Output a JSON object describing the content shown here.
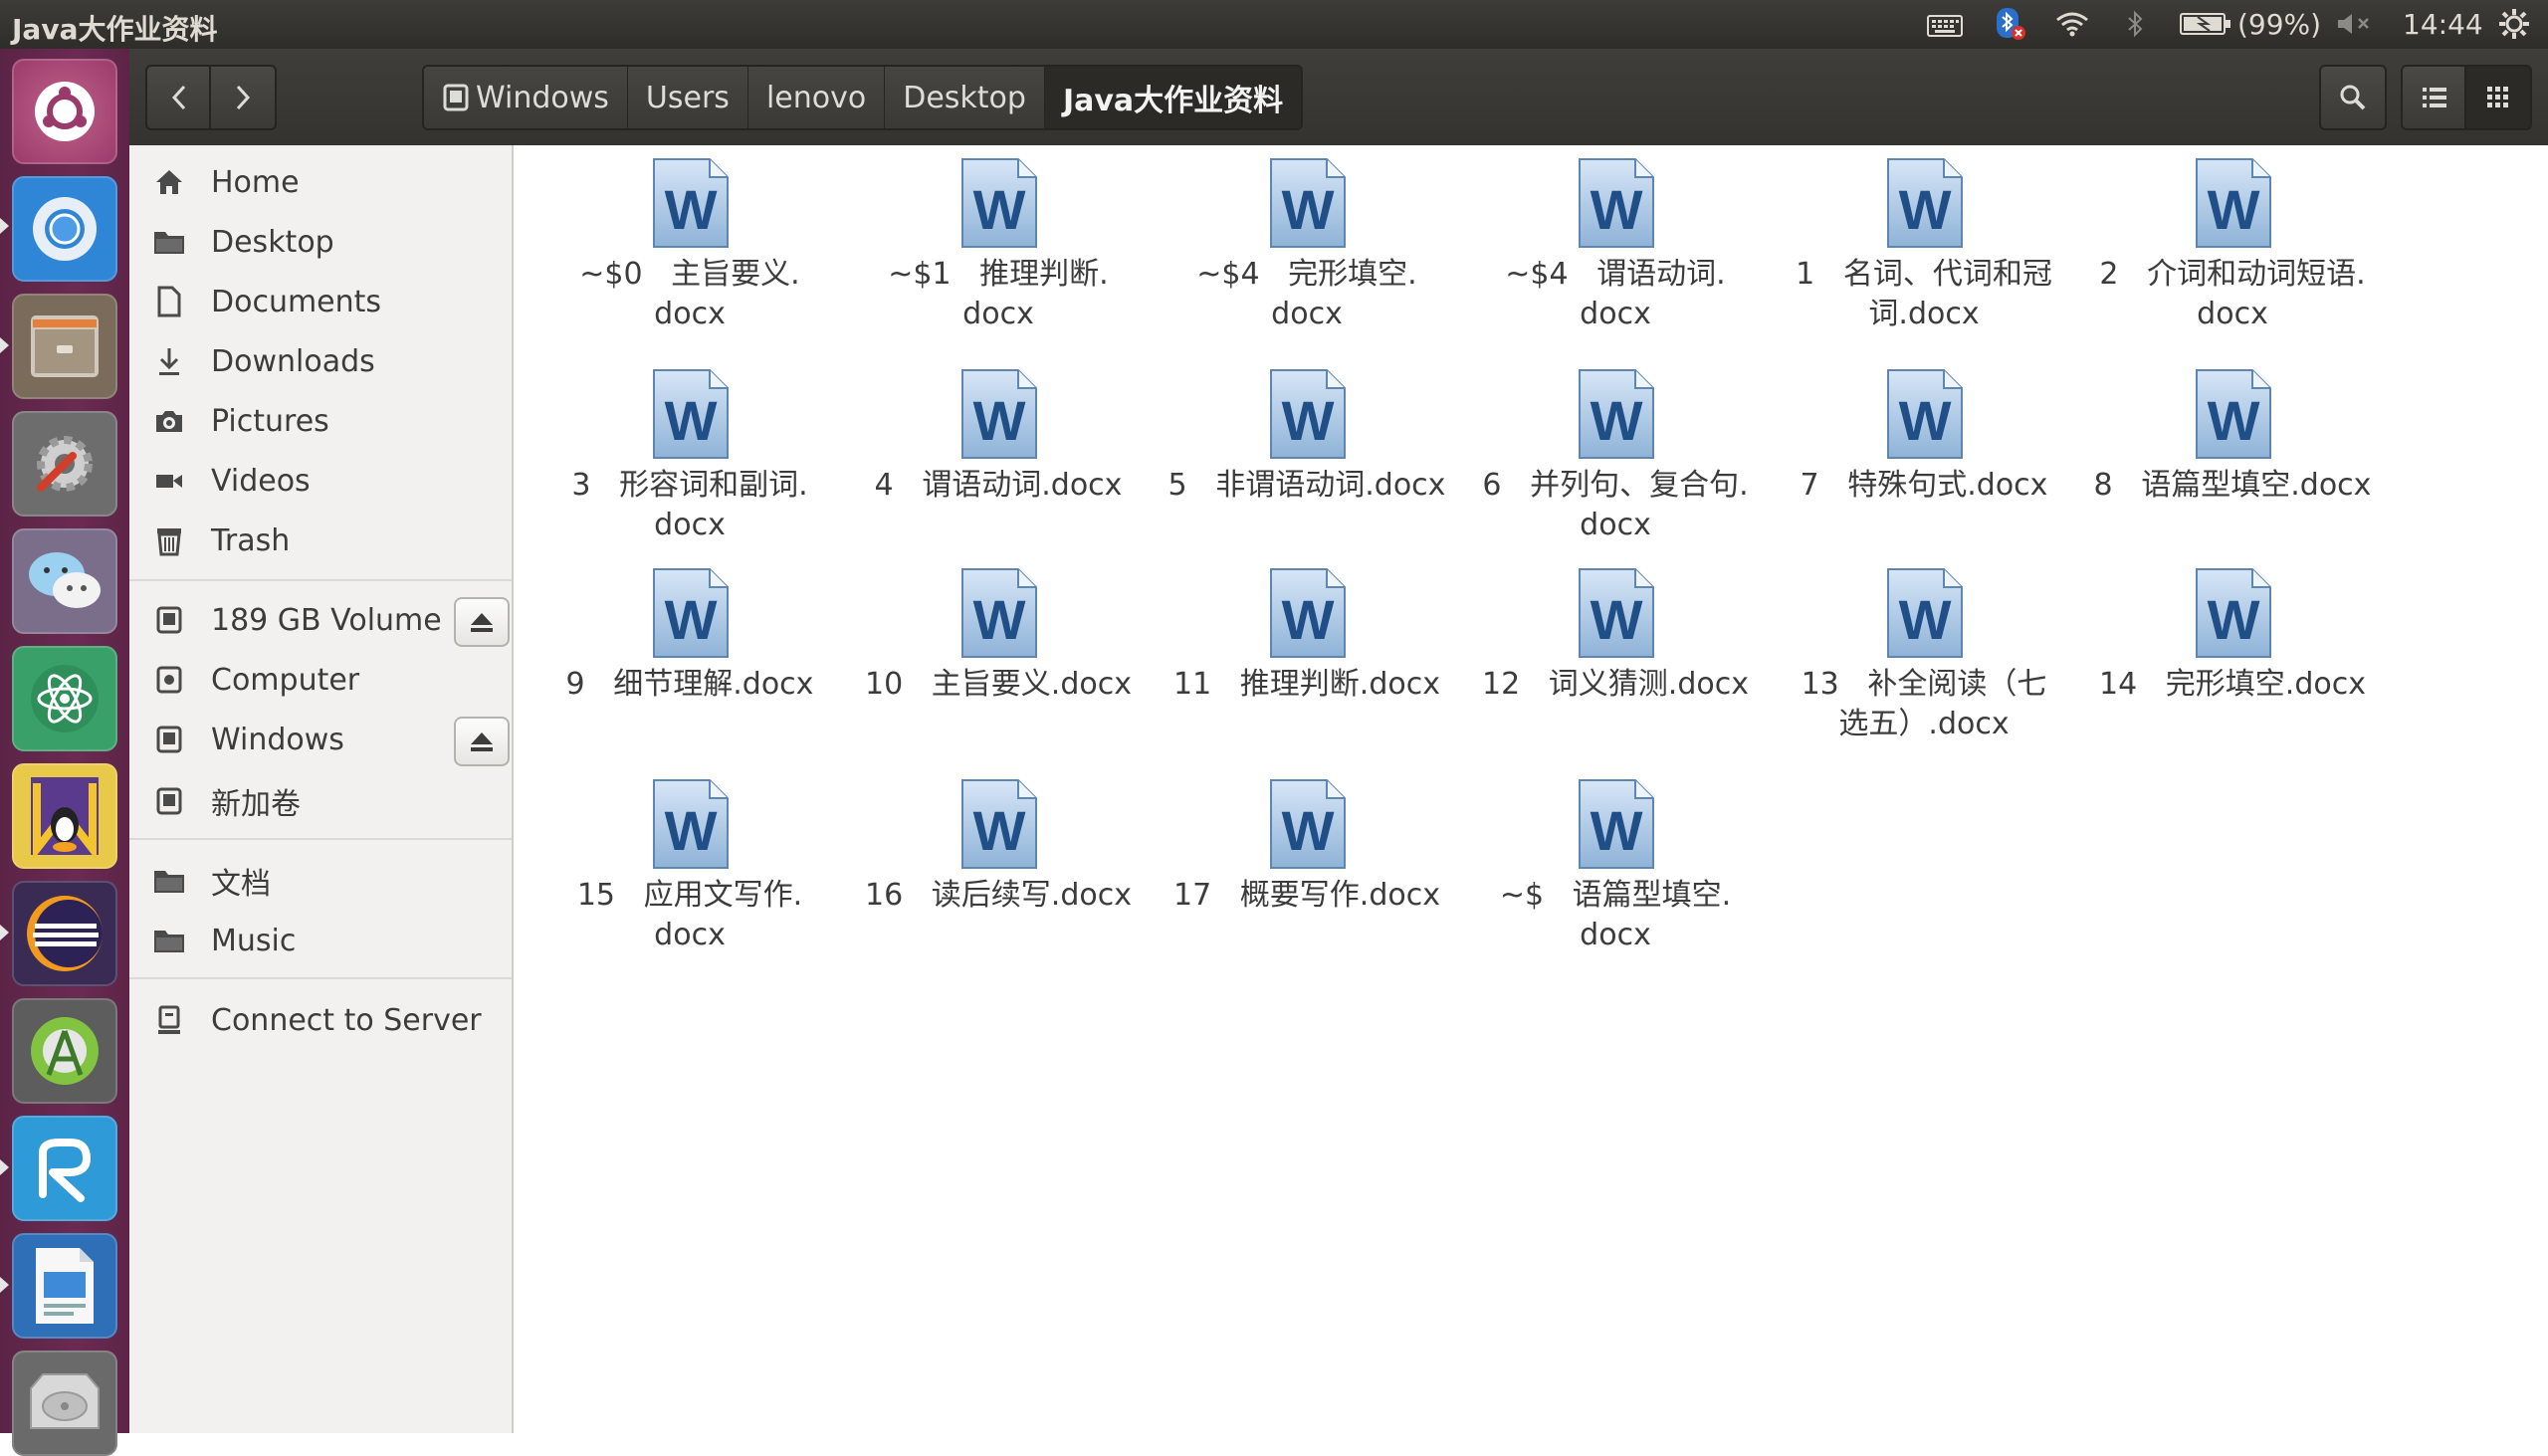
{
  "window": {
    "title": "Java大作业资料"
  },
  "panel": {
    "battery": "(99%)",
    "time": "14:44"
  },
  "breadcrumbs": [
    "Windows",
    "Users",
    "lenovo",
    "Desktop",
    "Java大作业资料"
  ],
  "sidebar": {
    "places": [
      "Home",
      "Desktop",
      "Documents",
      "Downloads",
      "Pictures",
      "Videos",
      "Trash"
    ],
    "devices": [
      "189 GB Volume",
      "Computer",
      "Windows",
      "新加卷"
    ],
    "bookmarks": [
      "文档",
      "Music"
    ],
    "network": [
      "Connect to Server"
    ]
  },
  "files": [
    {
      "name": "~$0  主旨要义.docx",
      "l1": "~$0   主旨要义.",
      "l2": "docx"
    },
    {
      "name": "~$1  推理判断.docx",
      "l1": "~$1   推理判断.",
      "l2": "docx"
    },
    {
      "name": "~$4  完形填空.docx",
      "l1": "~$4   完形填空.",
      "l2": "docx"
    },
    {
      "name": "~$4  谓语动词.docx",
      "l1": "~$4   谓语动词.",
      "l2": "docx"
    },
    {
      "name": "1  名词、代词和冠词.docx",
      "l1": "1   名词、代词和冠",
      "l2": "词.docx"
    },
    {
      "name": "2  介词和动词短语.docx",
      "l1": "2   介词和动词短语.",
      "l2": "docx"
    },
    {
      "name": "3  形容词和副词.docx",
      "l1": "3   形容词和副词.",
      "l2": "docx"
    },
    {
      "name": "4  谓语动词.docx",
      "l1": "4   谓语动词.docx",
      "l2": ""
    },
    {
      "name": "5  非谓语动词.docx",
      "l1": "5   非谓语动词.docx",
      "l2": ""
    },
    {
      "name": "6  并列句、复合句.docx",
      "l1": "6   并列句、复合句.",
      "l2": "docx"
    },
    {
      "name": "7  特殊句式.docx",
      "l1": "7   特殊句式.docx",
      "l2": ""
    },
    {
      "name": "8  语篇型填空.docx",
      "l1": "8   语篇型填空.docx",
      "l2": ""
    },
    {
      "name": "9  细节理解.docx",
      "l1": "9   细节理解.docx",
      "l2": ""
    },
    {
      "name": "10  主旨要义.docx",
      "l1": "10   主旨要义.docx",
      "l2": ""
    },
    {
      "name": "11  推理判断.docx",
      "l1": "11   推理判断.docx",
      "l2": ""
    },
    {
      "name": "12  词义猜测.docx",
      "l1": "12   词义猜测.docx",
      "l2": ""
    },
    {
      "name": "13  补全阅读（七选五）.docx",
      "l1": "13   补全阅读（七",
      "l2": "选五）.docx"
    },
    {
      "name": "14  完形填空.docx",
      "l1": "14   完形填空.docx",
      "l2": ""
    },
    {
      "name": "15  应用文写作.docx",
      "l1": "15   应用文写作.",
      "l2": "docx"
    },
    {
      "name": "16  读后续写.docx",
      "l1": "16   读后续写.docx",
      "l2": ""
    },
    {
      "name": "17  概要写作.docx",
      "l1": "17   概要写作.docx",
      "l2": ""
    },
    {
      "name": "~$  语篇型填空.docx",
      "l1": "~$   语篇型填空.",
      "l2": "docx"
    }
  ],
  "icons": {
    "file": "word-document-icon",
    "launcher": [
      "ubuntu-dash-icon",
      "chromium-icon",
      "file-manager-icon",
      "system-settings-icon",
      "wechat-icon",
      "atom-icon",
      "qq-icon",
      "eclipse-icon",
      "android-studio-icon",
      "r-studio-icon",
      "libreoffice-impress-icon",
      "disk-drive-icon"
    ]
  },
  "colors": {
    "launcher": "#6b2a52",
    "header": "#3c3b37",
    "sidebar": "#f2f1f0"
  }
}
